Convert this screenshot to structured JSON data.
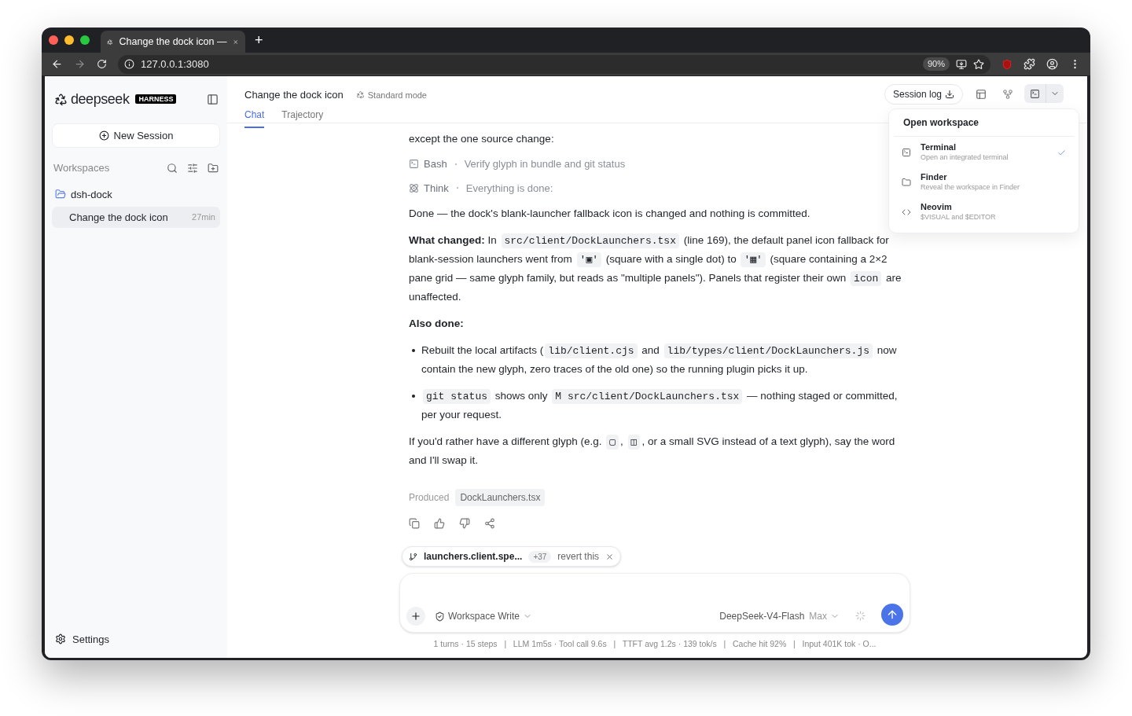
{
  "browser": {
    "tab_title": "Change the dock icon —",
    "new_tab": "+",
    "url": "127.0.0.1:3080",
    "zoom": "90%"
  },
  "sidebar": {
    "brand": "deepseek",
    "badge": "HARNESS",
    "new_session": "New Session",
    "workspaces_label": "Workspaces",
    "workspaces": [
      {
        "name": "dsh-dock",
        "expanded": true,
        "sessions": [
          {
            "title": "Change the dock icon",
            "age": "27min",
            "selected": true
          }
        ]
      }
    ],
    "settings": "Settings"
  },
  "header": {
    "title": "Change the dock icon",
    "mode": "Standard mode",
    "session_log": "Session log",
    "tabs": [
      {
        "label": "Chat",
        "selected": true
      },
      {
        "label": "Trajectory",
        "selected": false
      }
    ]
  },
  "dropdown": {
    "title": "Open workspace",
    "items": [
      {
        "kind": "terminal",
        "name": "Terminal",
        "description": "Open an integrated terminal",
        "checked": true
      },
      {
        "kind": "folder",
        "name": "Finder",
        "description": "Reveal the workspace in Finder",
        "checked": false
      },
      {
        "kind": "code",
        "name": "Neovim",
        "description": "$VISUAL and $EDITOR",
        "checked": false
      }
    ]
  },
  "blocks": [
    {
      "kind": "paragraph",
      "segments": [
        {
          "kind": "text",
          "text": "except the one source change:"
        }
      ]
    },
    {
      "kind": "terminal_tool",
      "name": "Bash",
      "detail": "Verify glyph in bundle and git status"
    },
    {
      "kind": "think_tool",
      "name": "Think",
      "detail": "Everything is done:"
    },
    {
      "kind": "paragraph",
      "segments": [
        {
          "kind": "text",
          "text": "Done — the dock's blank-launcher fallback icon is changed and nothing is committed."
        }
      ]
    },
    {
      "kind": "paragraph",
      "segments": [
        {
          "kind": "text",
          "text": "**What changed:** In "
        },
        {
          "kind": "code",
          "text": "src/client/DockLaunchers.tsx"
        },
        {
          "kind": "text",
          "text": " (line 169), the default panel icon fallback for blank-session launchers went from "
        },
        {
          "kind": "code",
          "text": "'▣'"
        },
        {
          "kind": "text",
          "text": " (square with a single dot) to "
        },
        {
          "kind": "code",
          "text": "'▦'"
        },
        {
          "kind": "text",
          "text": " (square containing a 2×2 pane grid — same glyph family, but reads as \"multiple panels\"). Panels that register their own "
        },
        {
          "kind": "code",
          "text": "icon"
        },
        {
          "kind": "text",
          "text": " are unaffected."
        }
      ]
    },
    {
      "kind": "heading",
      "segments": [
        {
          "kind": "text",
          "text": "Also done:"
        }
      ]
    },
    {
      "kind": "bullet",
      "segments": [
        {
          "kind": "text",
          "text": "Rebuilt the local artifacts ("
        },
        {
          "kind": "code",
          "text": "lib/client.cjs"
        },
        {
          "kind": "text",
          "text": " and "
        },
        {
          "kind": "code",
          "text": "lib/types/client/DockLaunchers.js"
        },
        {
          "kind": "text",
          "text": " now contain the new glyph, zero traces of the old one) so the running plugin picks it up."
        }
      ]
    },
    {
      "kind": "bullet",
      "segments": [
        {
          "kind": "code",
          "text": "git status"
        },
        {
          "kind": "text",
          "text": " shows only "
        },
        {
          "kind": "code",
          "text": "M src/client/DockLaunchers.tsx"
        },
        {
          "kind": "text",
          "text": " — nothing staged or committed, per your request."
        }
      ]
    },
    {
      "kind": "paragraph",
      "segments": [
        {
          "kind": "text",
          "text": "If you'd rather have a different glyph (e.g. "
        },
        {
          "kind": "code",
          "text": "▢"
        },
        {
          "kind": "text",
          "text": ", "
        },
        {
          "kind": "code",
          "text": "◫"
        },
        {
          "kind": "text",
          "text": ", or a small SVG instead of a text glyph), say the word and I'll swap it."
        }
      ]
    }
  ],
  "produced": {
    "label": "Produced",
    "file": "DockLaunchers.tsx"
  },
  "change_chip": {
    "file": "launchers.client.spe...",
    "count": "+37",
    "action": "revert this"
  },
  "composer": {
    "mode": "Workspace Write",
    "model": "DeepSeek-V4-Flash",
    "effort": "Max"
  },
  "status_bar": "1 turns · 15 steps   |   LLM 1m5s · Tool call 9.6s   |   TTFT avg 1.2s · 139 tok/s   |   Cache hit 92%   |   Input 401K tok · O..."
}
